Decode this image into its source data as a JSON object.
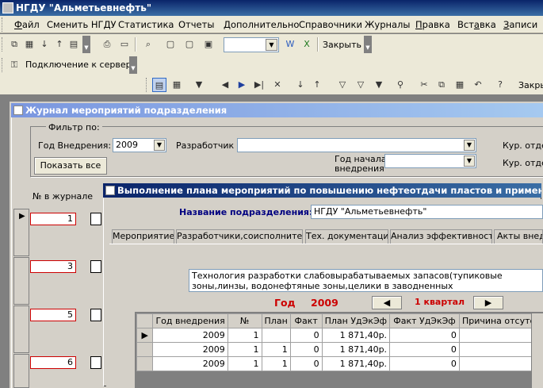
{
  "app": {
    "title": "НГДУ \"Альметьевнефть\""
  },
  "menu": [
    {
      "pre": "",
      "u": "Ф",
      "post": "айл"
    },
    {
      "pre": "Сменить НГДУ",
      "u": "",
      "post": ""
    },
    {
      "pre": "Статистика",
      "u": "",
      "post": ""
    },
    {
      "pre": "Отчеты",
      "u": "",
      "post": ""
    },
    {
      "pre": "Дополнительно",
      "u": "",
      "post": ""
    },
    {
      "pre": "Справочники",
      "u": "",
      "post": ""
    },
    {
      "pre": "Журналы",
      "u": "",
      "post": ""
    },
    {
      "pre": "",
      "u": "П",
      "post": "равка"
    },
    {
      "pre": "Вст",
      "u": "а",
      "post": "вка"
    },
    {
      "pre": "",
      "u": "З",
      "post": "аписи"
    }
  ],
  "toolbar": {
    "close_label": "Закрыть",
    "close_label2": "Закры",
    "connect_label": "Подключение к серверу"
  },
  "journal": {
    "title": "Журнал мероприятий подразделения",
    "filter_label": "Фильтр по:",
    "year_label": "Год Внедрения:",
    "year_value": "2009",
    "developer_label": "Разработчик",
    "developer_value": "",
    "start_year_label": "Год начала внедрения",
    "start_year_value": "",
    "kur_otdel1": "Кур. отдел",
    "kur_otdel2": "Кур. отдел",
    "show_all": "Показать все",
    "num_header": "№ в журнале",
    "rows": [
      "1",
      "3",
      "5",
      "6"
    ]
  },
  "plan": {
    "title": "Выполнение плана мероприятий по повышению нефтеотдачи пластов и применения передо",
    "dept_label": "Название подразделения:",
    "dept_value": "НГДУ \"Альметьевнефть\"",
    "tabs": [
      "Мероприятие",
      "Разработчики,соисполнители",
      "Тех. документация",
      "Анализ эффективности",
      "Акты внедр"
    ],
    "tech_text": "Технология разработки слабовырабатываемых запасов(тупиковые зоны,линзы, водонефтяные зоны,целики в заводненных зонах,микроструктуры в заводненных зонах)с горизонт. и",
    "year_label": "Год",
    "year_value": "2009",
    "quarter": "1  квартал",
    "columns": [
      "Год внедрения",
      "№",
      "План",
      "Факт",
      "План УдЭкЭф",
      "Факт УдЭкЭф",
      "Причина отсутст"
    ],
    "rows": [
      [
        "2009",
        "1",
        "",
        "0",
        "1 871,40р.",
        "0",
        ""
      ],
      [
        "2009",
        "1",
        "1",
        "0",
        "1 871,40р.",
        "0",
        ""
      ],
      [
        "2009",
        "1",
        "1",
        "0",
        "1 871,40р.",
        "0",
        ""
      ]
    ]
  },
  "colors": {
    "title_bar": "#0a246a",
    "accent_red": "#cc0000",
    "dept_label": "#000080"
  }
}
